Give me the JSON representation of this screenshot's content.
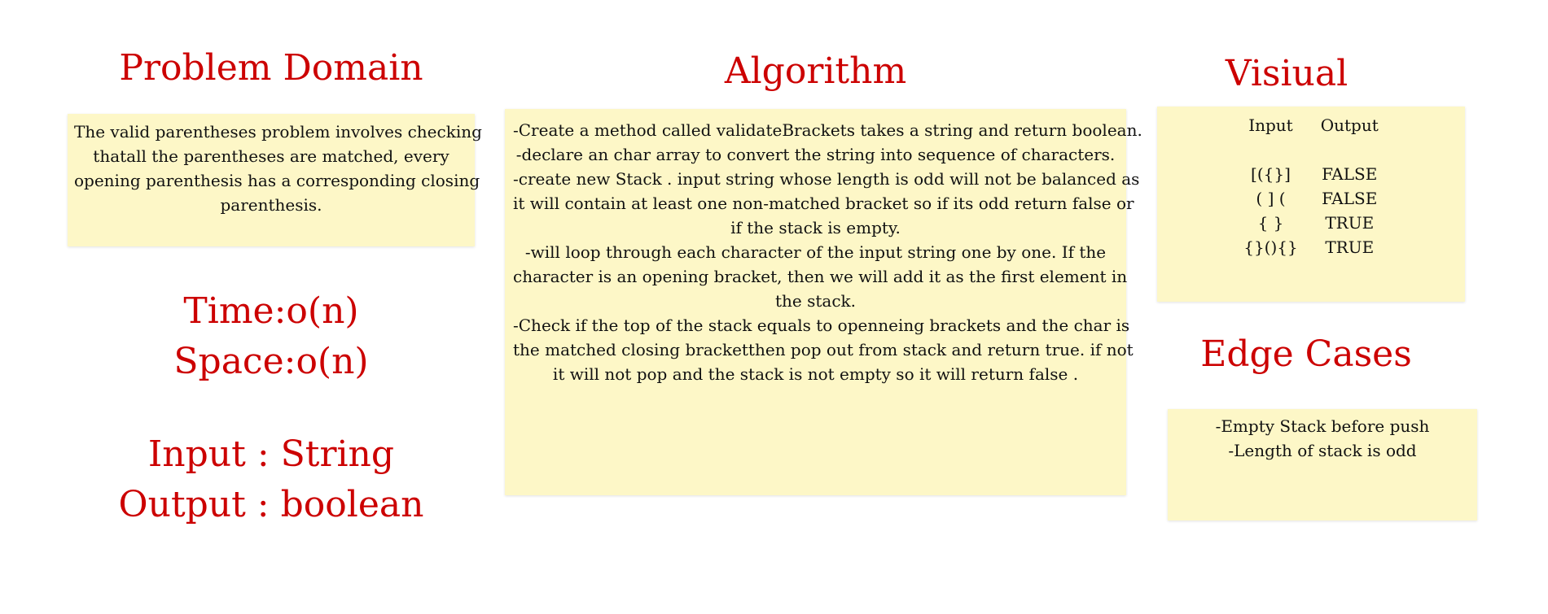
{
  "problem_domain": {
    "heading": "Problem Domain",
    "lines": [
      "The valid parentheses problem involves checking",
      "thatall the parentheses are matched, every",
      "opening parenthesis has a corresponding closing",
      "parenthesis."
    ]
  },
  "complexity": {
    "time": "Time:o(n)",
    "space": "Space:o(n)"
  },
  "io": {
    "input": "Input : String",
    "output": "Output : boolean"
  },
  "algorithm": {
    "heading": "Algorithm",
    "lines": [
      "-Create a method called validateBrackets takes a string and return boolean.",
      "-declare an char array to convert the string into sequence of characters.",
      "-create new Stack . input string whose length is odd will not be balanced as",
      "it will contain at least one non-matched bracket so if its odd return false or",
      "if the stack is empty.",
      "-will loop through each character of the input string one by one. If the",
      "character is an opening bracket, then we will add it as the first element in",
      "the stack.",
      "-Check if the top of the stack equals to openneing brackets and the char is",
      "the matched closing bracketthen pop out from stack and return true. if not",
      "it will not pop and the stack is not empty so it will return false ."
    ]
  },
  "visual": {
    "heading": "Visiual",
    "columns": [
      "Input",
      "Output"
    ],
    "rows": [
      {
        "input": "[({}]",
        "output": "FALSE"
      },
      {
        "input": "( ] (",
        "output": "FALSE"
      },
      {
        "input": "{ }",
        "output": "TRUE"
      },
      {
        "input": "{}(){}",
        "output": "TRUE"
      }
    ]
  },
  "edge_cases": {
    "heading": "Edge Cases",
    "lines": [
      "-Empty Stack before push",
      "-Length of stack is odd"
    ]
  }
}
